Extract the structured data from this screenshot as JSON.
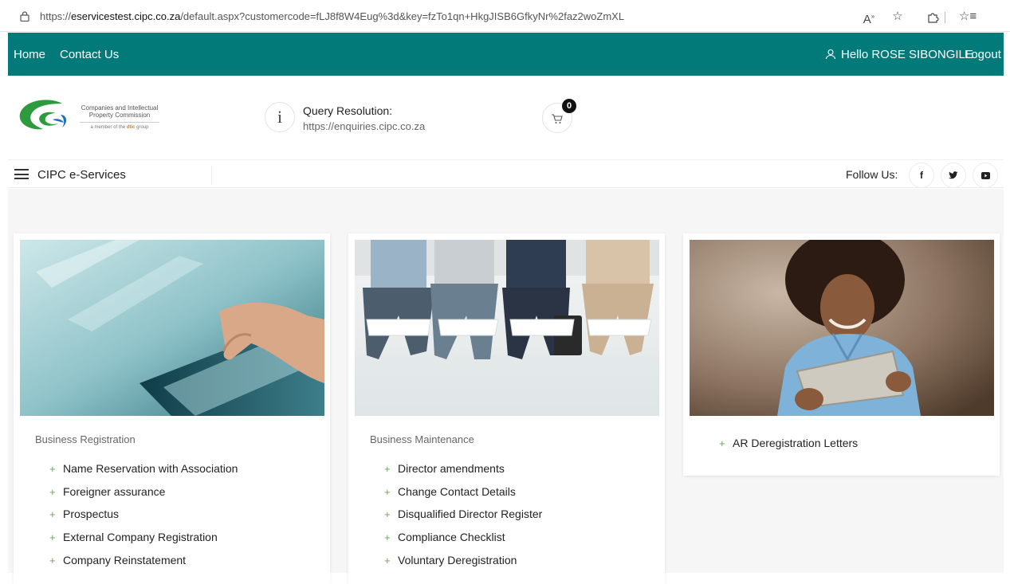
{
  "browser": {
    "url_prefix": "https://",
    "url_domain": "eservicestest.cipc.co.za",
    "url_rest": "/default.aspx?customercode=fLJ8f8W4Eug%3d&key=fzTo1qn+HkgJISB6GfkyNr%2faz2woZmXL",
    "icons": [
      "lock-icon",
      "read-aloud-icon",
      "favorite-star-icon",
      "extensions-icon",
      "favorites-list-icon"
    ]
  },
  "nav": {
    "home": "Home",
    "contact": "Contact Us",
    "greeting": "Hello ROSE SIBONGILE",
    "logout": "Logout",
    "bg_color": "#037a7a"
  },
  "header": {
    "logo_line1": "Companies and Intellectual",
    "logo_line2": "Property Commission",
    "logo_sub_pre": "a member of the",
    "logo_sub_brand": "dtic",
    "logo_sub_post": "group",
    "info_glyph": "i",
    "query_title": "Query Resolution:",
    "query_url": "https://enquiries.cipc.co.za",
    "cart_count": "0"
  },
  "subbar": {
    "title": "CIPC e-Services",
    "follow": "Follow Us:",
    "social": [
      "f",
      "t",
      "y"
    ]
  },
  "cards": [
    {
      "title": "Business Registration",
      "items": [
        "Name Reservation with Association",
        "Foreigner assurance",
        "Prospectus",
        "External Company Registration",
        "Company Reinstatement"
      ]
    },
    {
      "title": "Business Maintenance",
      "items": [
        "Director amendments",
        "Change Contact Details",
        "Disqualified Director Register",
        "Compliance Checklist",
        "Voluntary Deregistration"
      ]
    },
    {
      "title": "",
      "items": [
        "AR Deregistration Letters"
      ]
    }
  ],
  "plus_glyph": "+"
}
